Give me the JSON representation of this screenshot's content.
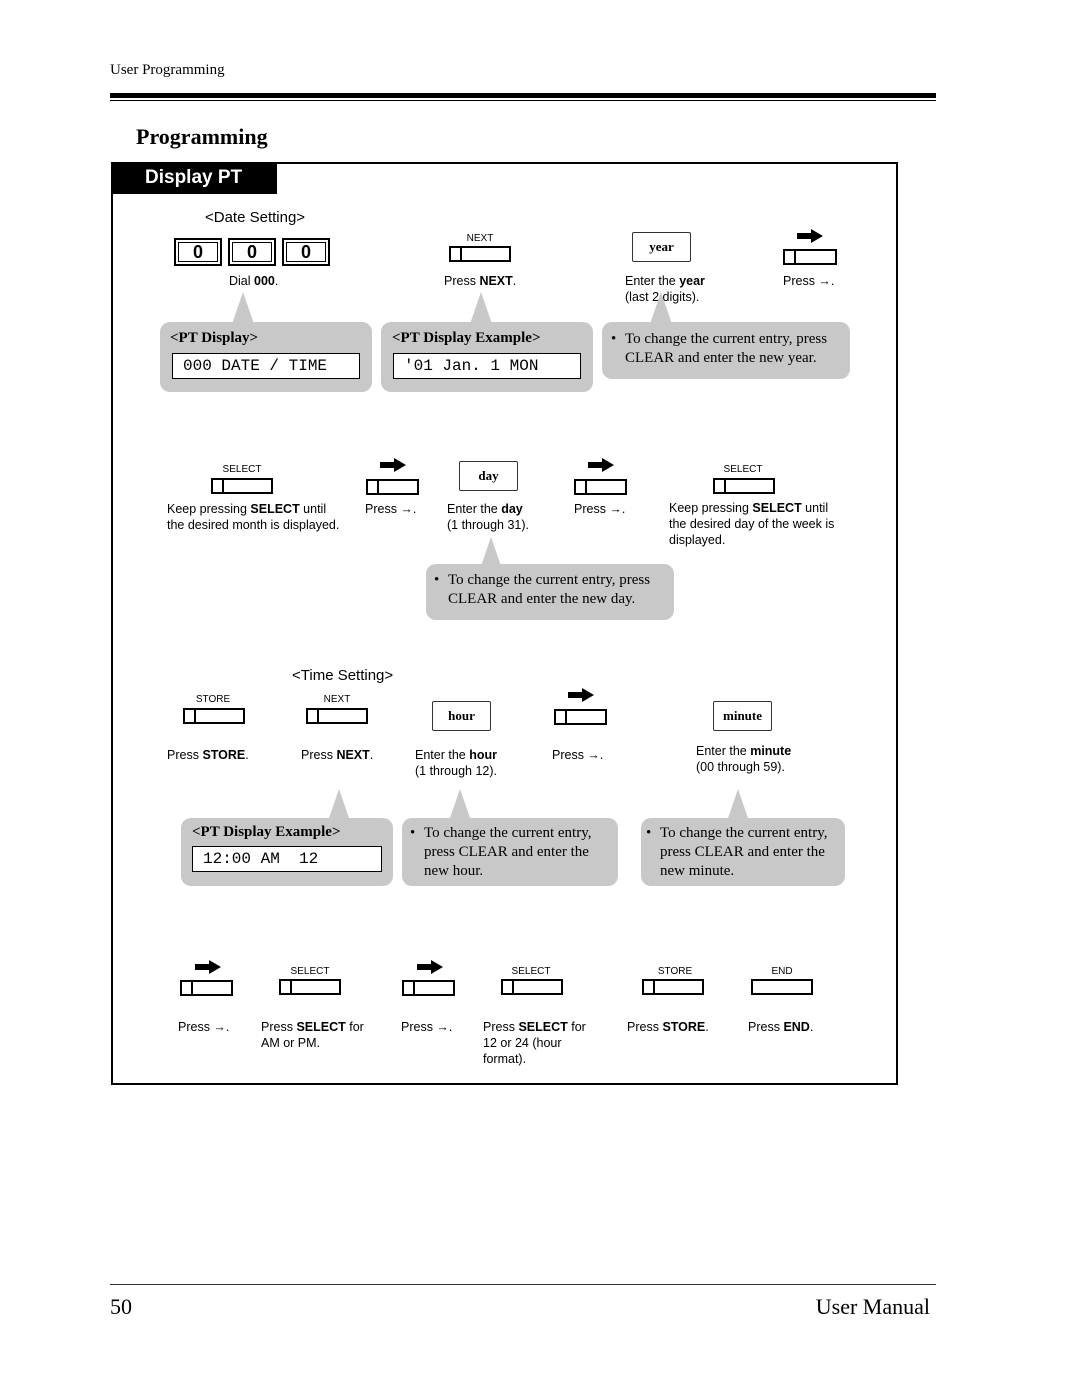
{
  "header": {
    "running_head": "User Programming"
  },
  "section_title": "Programming",
  "panel": {
    "tab_label": "Display PT",
    "date_setting": {
      "heading": "<Date Setting>",
      "dial_keys": [
        "0",
        "0",
        "0"
      ],
      "dial_caption_pre": "Dial ",
      "dial_caption_bold": "000",
      "dial_caption_post": ".",
      "next": {
        "label": "NEXT",
        "caption_pre": "Press ",
        "caption_bold": "NEXT",
        "caption_post": "."
      },
      "year": {
        "entry": "year",
        "caption_pre": "Enter the ",
        "caption_bold": "year",
        "caption_line2": "(last 2 digits)."
      },
      "arrow1": {
        "caption": "Press →."
      },
      "pt_display": {
        "title": "<PT Display>",
        "lcd": "000 DATE / TIME"
      },
      "pt_display_example": {
        "title": "<PT Display Example>",
        "lcd": "'01 Jan. 1 MON"
      },
      "year_note": {
        "bullet": "•",
        "text": "To change the current entry, press CLEAR and enter the new year."
      },
      "select_month": {
        "label": "SELECT",
        "caption_pre": "Keep pressing ",
        "caption_bold": "SELECT",
        "caption_post": " until",
        "caption_line2": "the desired month is displayed."
      },
      "arrow2": {
        "caption": "Press →."
      },
      "day": {
        "entry": "day",
        "caption_pre": "Enter the ",
        "caption_bold": "day",
        "caption_line2": "(1 through 31)."
      },
      "arrow3": {
        "caption": "Press →."
      },
      "select_weekday": {
        "label": "SELECT",
        "caption_pre": "Keep pressing ",
        "caption_bold": "SELECT",
        "caption_post": " until",
        "caption_line2": "the desired day of the week is",
        "caption_line3": "displayed."
      },
      "day_note": {
        "bullet": "•",
        "text": "To change the current entry, press CLEAR and enter the new day."
      }
    },
    "time_setting": {
      "heading": "<Time Setting>",
      "store": {
        "label": "STORE",
        "caption_pre": "Press ",
        "caption_bold": "STORE",
        "caption_post": "."
      },
      "next": {
        "label": "NEXT",
        "caption_pre": "Press ",
        "caption_bold": "NEXT",
        "caption_post": "."
      },
      "hour": {
        "entry": "hour",
        "caption_pre": "Enter the ",
        "caption_bold": "hour",
        "caption_line2": "(1 through 12)."
      },
      "arrow1": {
        "caption": "Press →."
      },
      "minute": {
        "entry": "minute",
        "caption_pre": "Enter the ",
        "caption_bold": "minute",
        "caption_line2": "(00 through 59)."
      },
      "pt_display_example": {
        "title": "<PT Display Example>",
        "lcd": "12:00 AM  12"
      },
      "hour_note": {
        "bullet": "•",
        "text": "To change the current entry, press CLEAR and enter the new hour."
      },
      "minute_note": {
        "bullet": "•",
        "text": "To change the current entry, press CLEAR and enter the new minute."
      },
      "arrow2": {
        "caption": "Press →."
      },
      "select_ampm": {
        "label": "SELECT",
        "caption_pre": "Press ",
        "caption_bold": "SELECT",
        "caption_post": " for",
        "caption_line2": "AM or PM."
      },
      "arrow3": {
        "caption": "Press →."
      },
      "select_format": {
        "label": "SELECT",
        "caption_pre": "Press ",
        "caption_bold": "SELECT",
        "caption_post": " for",
        "caption_line2": "12 or 24 (hour",
        "caption_line3": "format)."
      },
      "store2": {
        "label": "STORE",
        "caption_pre": "Press ",
        "caption_bold": "STORE",
        "caption_post": "."
      },
      "end": {
        "label": "END",
        "caption_pre": "Press ",
        "caption_bold": "END",
        "caption_post": "."
      }
    }
  },
  "icons": {
    "arrow": "right-arrow-icon"
  },
  "footer": {
    "page_number": "50",
    "title": "User Manual"
  }
}
